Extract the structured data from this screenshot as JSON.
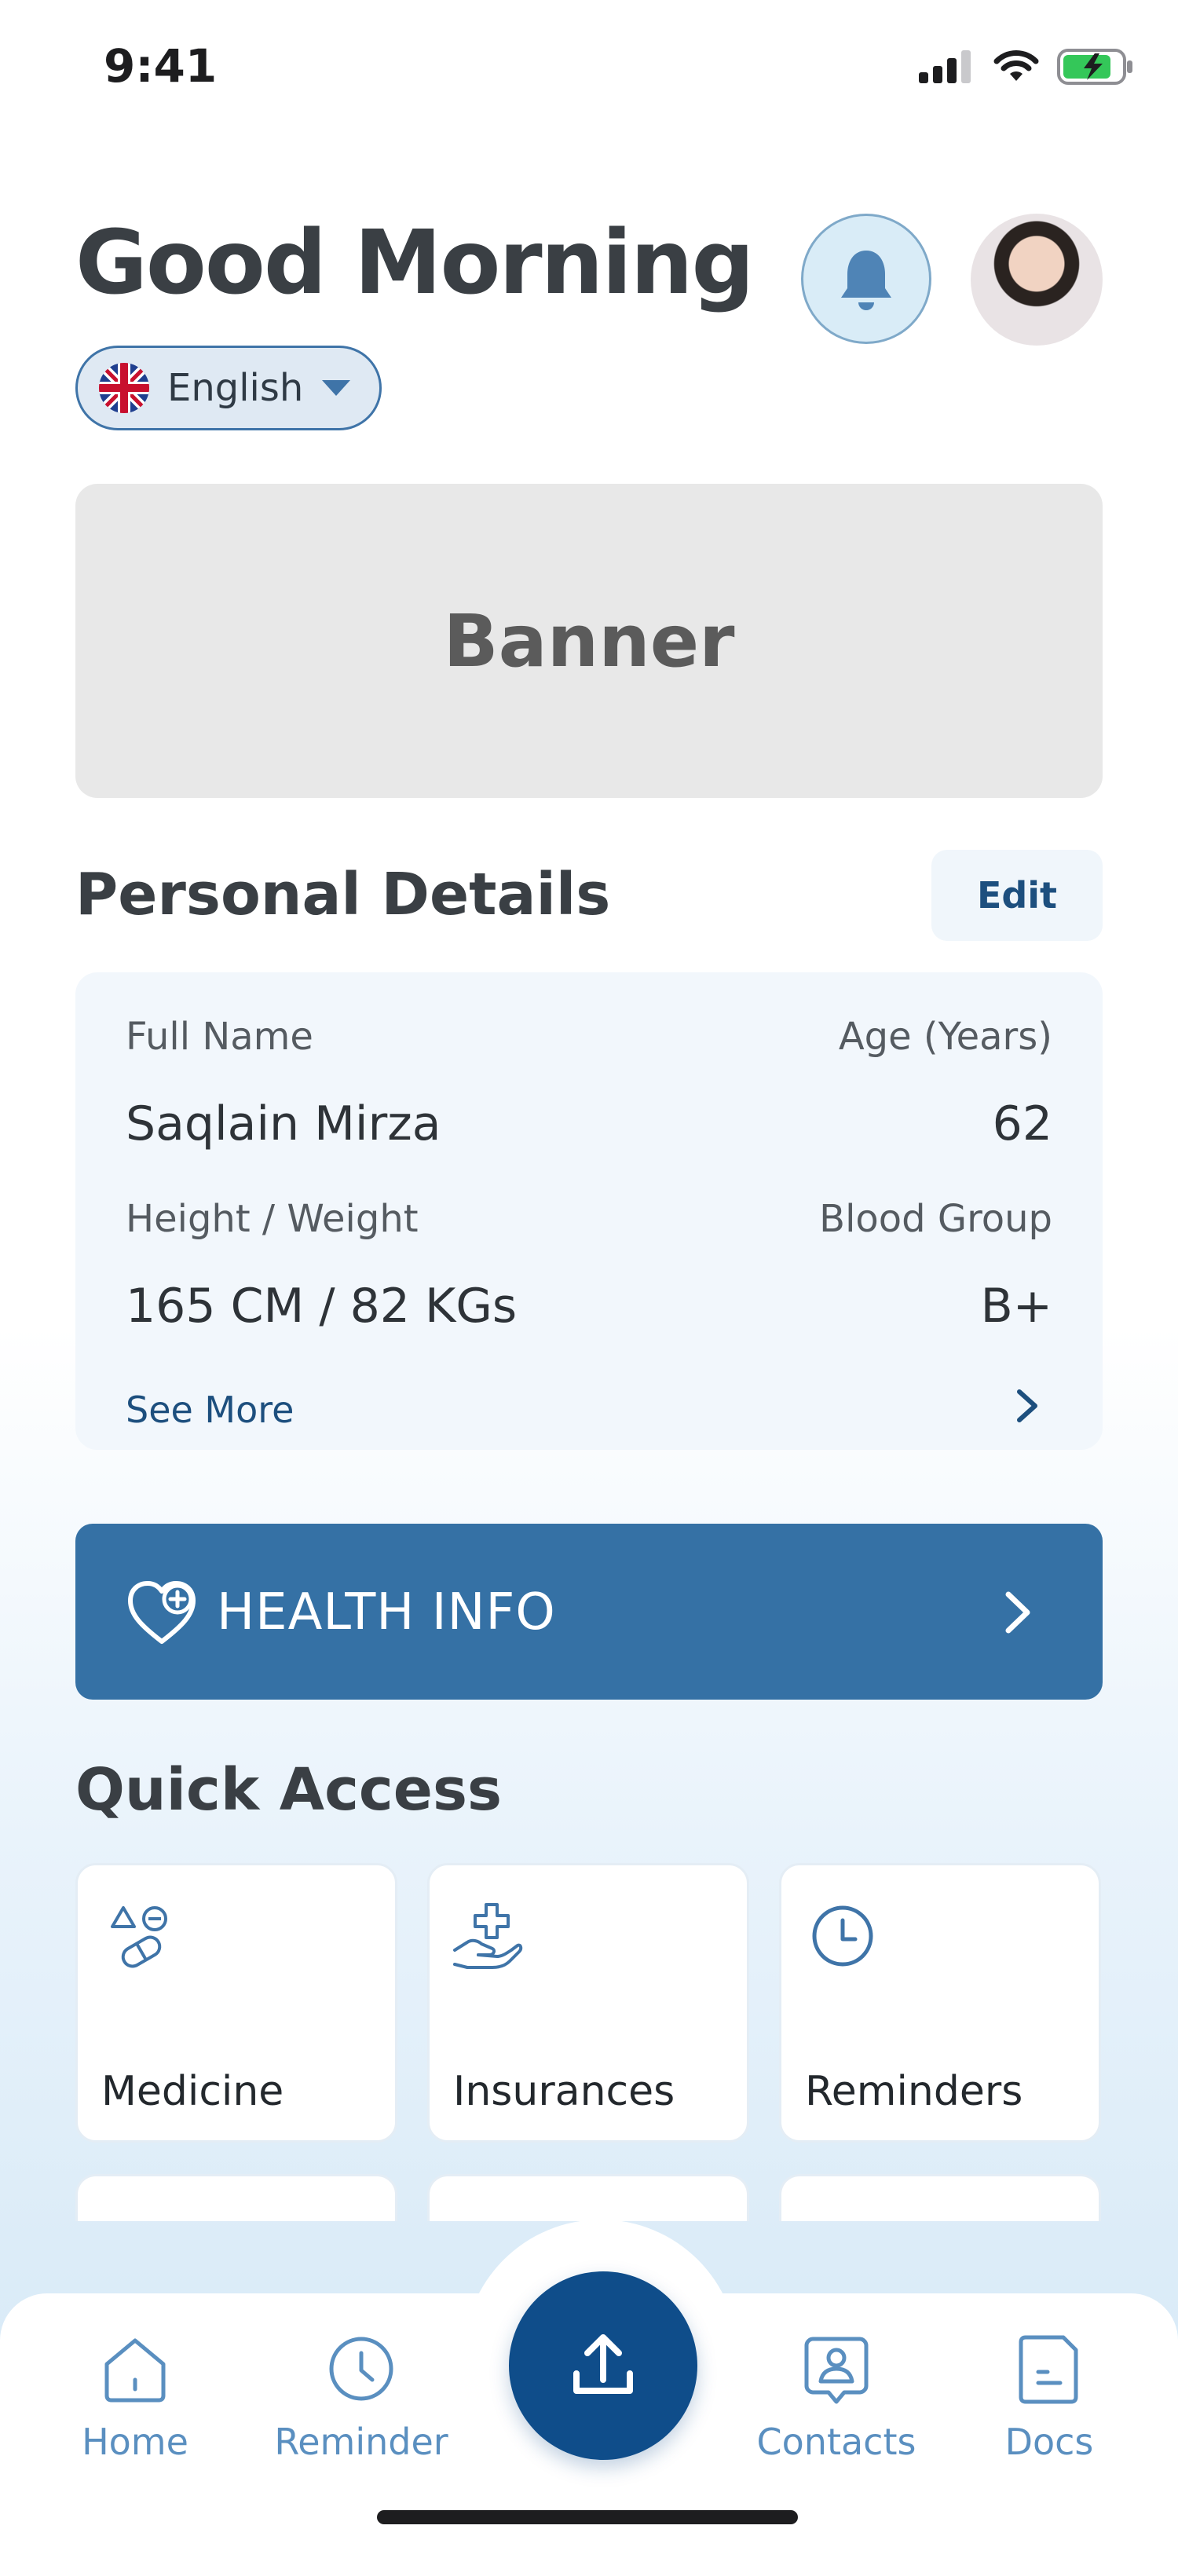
{
  "status_bar": {
    "time": "9:41"
  },
  "header": {
    "greeting": "Good Morning",
    "language": "English"
  },
  "banner": {
    "label": "Banner"
  },
  "personal_details": {
    "title": "Personal Details",
    "edit_label": "Edit",
    "fields": [
      {
        "label": "Full Name",
        "value": "Saqlain Mirza"
      },
      {
        "label": "Age (Years)",
        "value": "62"
      },
      {
        "label": "Height / Weight",
        "value": "165 CM / 82 KGs"
      },
      {
        "label": "Blood Group",
        "value": "B+"
      }
    ],
    "see_more": "See More"
  },
  "health_info": {
    "label": "HEALTH INFO"
  },
  "quick_access": {
    "title": "Quick Access",
    "tiles": [
      {
        "label": "Medicine",
        "icon": "medicine-icon"
      },
      {
        "label": "Insurances",
        "icon": "insurance-icon"
      },
      {
        "label": "Reminders",
        "icon": "clock-icon"
      }
    ]
  },
  "nav": {
    "items": [
      {
        "label": "Home",
        "icon": "home-icon"
      },
      {
        "label": "Reminder",
        "icon": "clock-icon"
      },
      {
        "label": "Contacts",
        "icon": "contact-icon"
      },
      {
        "label": "Docs",
        "icon": "document-icon"
      }
    ],
    "center_icon": "upload-icon"
  },
  "colors": {
    "primary": "#0f4d8a",
    "accent": "#3571a5",
    "nav_label": "#5a8fc0"
  }
}
